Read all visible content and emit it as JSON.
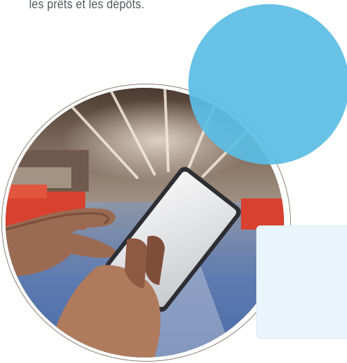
{
  "intro": {
    "text": "les prêts et les dépôts."
  },
  "decor": {
    "accent_circle_color": "#5bbde4",
    "ring_color": "#8a7f73",
    "card_color": "#e9f5fb"
  },
  "photo": {
    "subject": "warehouse-tablet-photo"
  }
}
